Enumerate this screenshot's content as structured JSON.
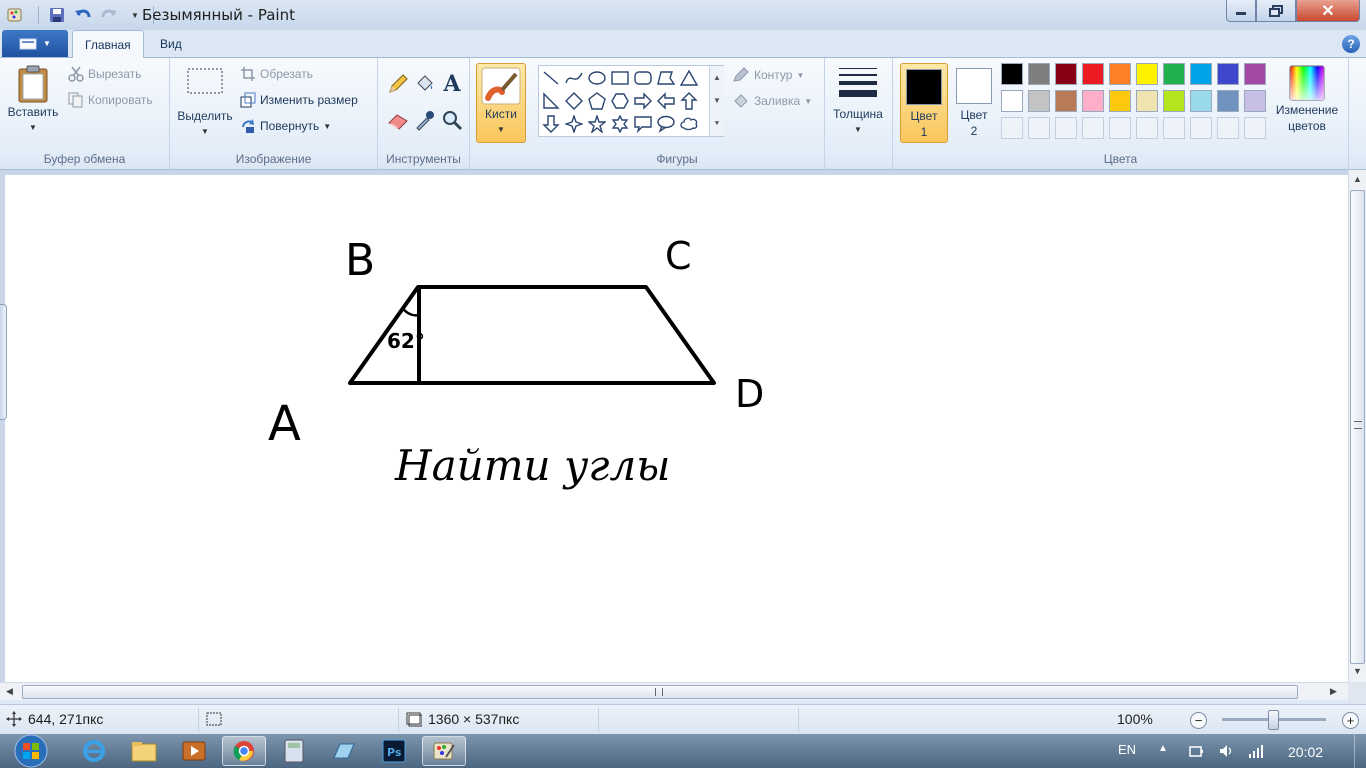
{
  "window": {
    "title": "Безымянный - Paint",
    "close_glyph": "✕"
  },
  "tabs": {
    "home": "Главная",
    "view": "Вид"
  },
  "help_glyph": "?",
  "clipboard": {
    "paste": "Вставить",
    "cut": "Вырезать",
    "copy": "Копировать",
    "label": "Буфер обмена"
  },
  "image": {
    "select": "Выделить",
    "crop": "Обрезать",
    "resize": "Изменить размер",
    "rotate": "Повернуть",
    "label": "Изображение"
  },
  "tools": {
    "label": "Инструменты",
    "text_glyph": "A"
  },
  "brushes": {
    "label": "Кисти"
  },
  "shapes": {
    "outline": "Контур",
    "fill": "Заливка",
    "label": "Фигуры"
  },
  "size": {
    "label": "Толщина"
  },
  "colors": {
    "color1_line1": "Цвет",
    "color1_line2": "1",
    "color2_line1": "Цвет",
    "color2_line2": "2",
    "edit_line1": "Изменение",
    "edit_line2": "цветов",
    "label": "Цвета",
    "color1_value": "#000000",
    "color2_value": "#ffffff",
    "palette_row1": [
      "#000000",
      "#7f7f7f",
      "#880015",
      "#ed1c24",
      "#ff7f27",
      "#fff200",
      "#22b14c",
      "#00a2e8",
      "#3f48cc",
      "#a349a4"
    ],
    "palette_row2": [
      "#ffffff",
      "#c3c3c3",
      "#b97a57",
      "#ffaec9",
      "#ffc90e",
      "#efe4b0",
      "#b5e61d",
      "#99d9ea",
      "#7092be",
      "#c8bfe7"
    ]
  },
  "drawing": {
    "label_b": "B",
    "label_c": "C",
    "label_a": "A",
    "label_d": "D",
    "angle": "62°",
    "task": "Найти углы"
  },
  "status": {
    "cursor": "644, 271пкс",
    "dimensions": "1360 × 537пкс",
    "zoom": "100%",
    "zoom_minus": "−",
    "zoom_plus": "+"
  },
  "taskbar": {
    "lang": "EN",
    "time": "20:02"
  }
}
